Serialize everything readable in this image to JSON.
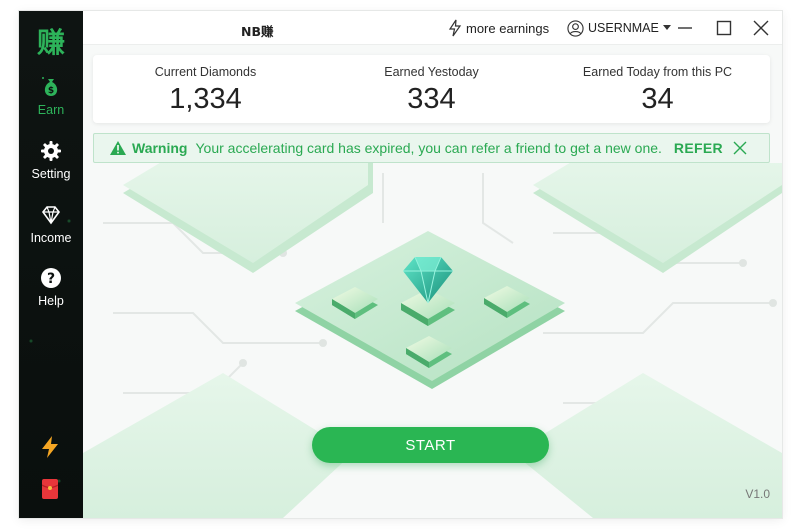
{
  "sidebar": {
    "logo": "赚",
    "items": [
      {
        "label": "Earn",
        "icon": "money-bag-icon",
        "active": true
      },
      {
        "label": "Setting",
        "icon": "gear-icon",
        "active": false
      },
      {
        "label": "Income",
        "icon": "diamond-icon",
        "active": false
      },
      {
        "label": "Help",
        "icon": "question-icon",
        "active": false
      }
    ],
    "bottom_icons": [
      "lightning-bolt-icon",
      "red-envelope-icon"
    ]
  },
  "titlebar": {
    "title": "NB赚",
    "more_earnings": "more earnings",
    "username": "USERNMAE"
  },
  "stats": [
    {
      "label": "Current Diamonds",
      "value": "1,334"
    },
    {
      "label": "Earned Yestoday",
      "value": "334"
    },
    {
      "label": "Earned Today from this PC",
      "value": "34"
    }
  ],
  "warning": {
    "title": "Warning",
    "message": "Your accelerating card has expired, you can refer a friend to get a new one.",
    "action": "REFER"
  },
  "start_label": "START",
  "version": "V1.0",
  "colors": {
    "accent": "#2ab653",
    "sidebar_bg": "#0c1110",
    "warning_bg": "#eaf6ee",
    "tile": "#dff3e5"
  }
}
